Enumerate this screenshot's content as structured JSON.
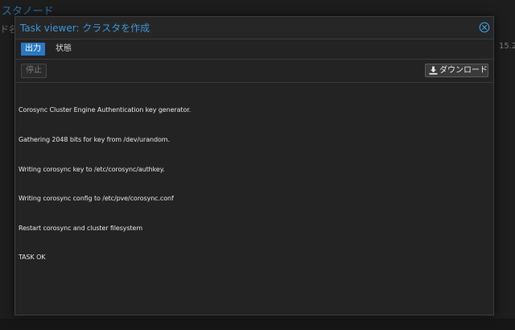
{
  "background": {
    "title": "スタノード",
    "column_header": "ド名",
    "version": "15.2"
  },
  "dialog": {
    "title": "Task viewer: クラスタを作成",
    "close_icon": "close-circle-icon",
    "tabs": [
      {
        "label": "出力",
        "active": true
      },
      {
        "label": "状態",
        "active": false
      }
    ],
    "toolbar": {
      "stop_label": "停止",
      "stop_disabled": true,
      "download_label": "ダウンロード",
      "download_icon": "download-icon"
    },
    "log_lines": [
      "Corosync Cluster Engine Authentication key generator.",
      "Gathering 2048 bits for key from /dev/urandom.",
      "Writing corosync key to /etc/corosync/authkey.",
      "Writing corosync config to /etc/pve/corosync.conf",
      "Restart corosync and cluster filesystem",
      "TASK OK"
    ]
  },
  "colors": {
    "accent": "#3c95d6",
    "active_tab": "#2a79c1",
    "background": "#232323"
  }
}
